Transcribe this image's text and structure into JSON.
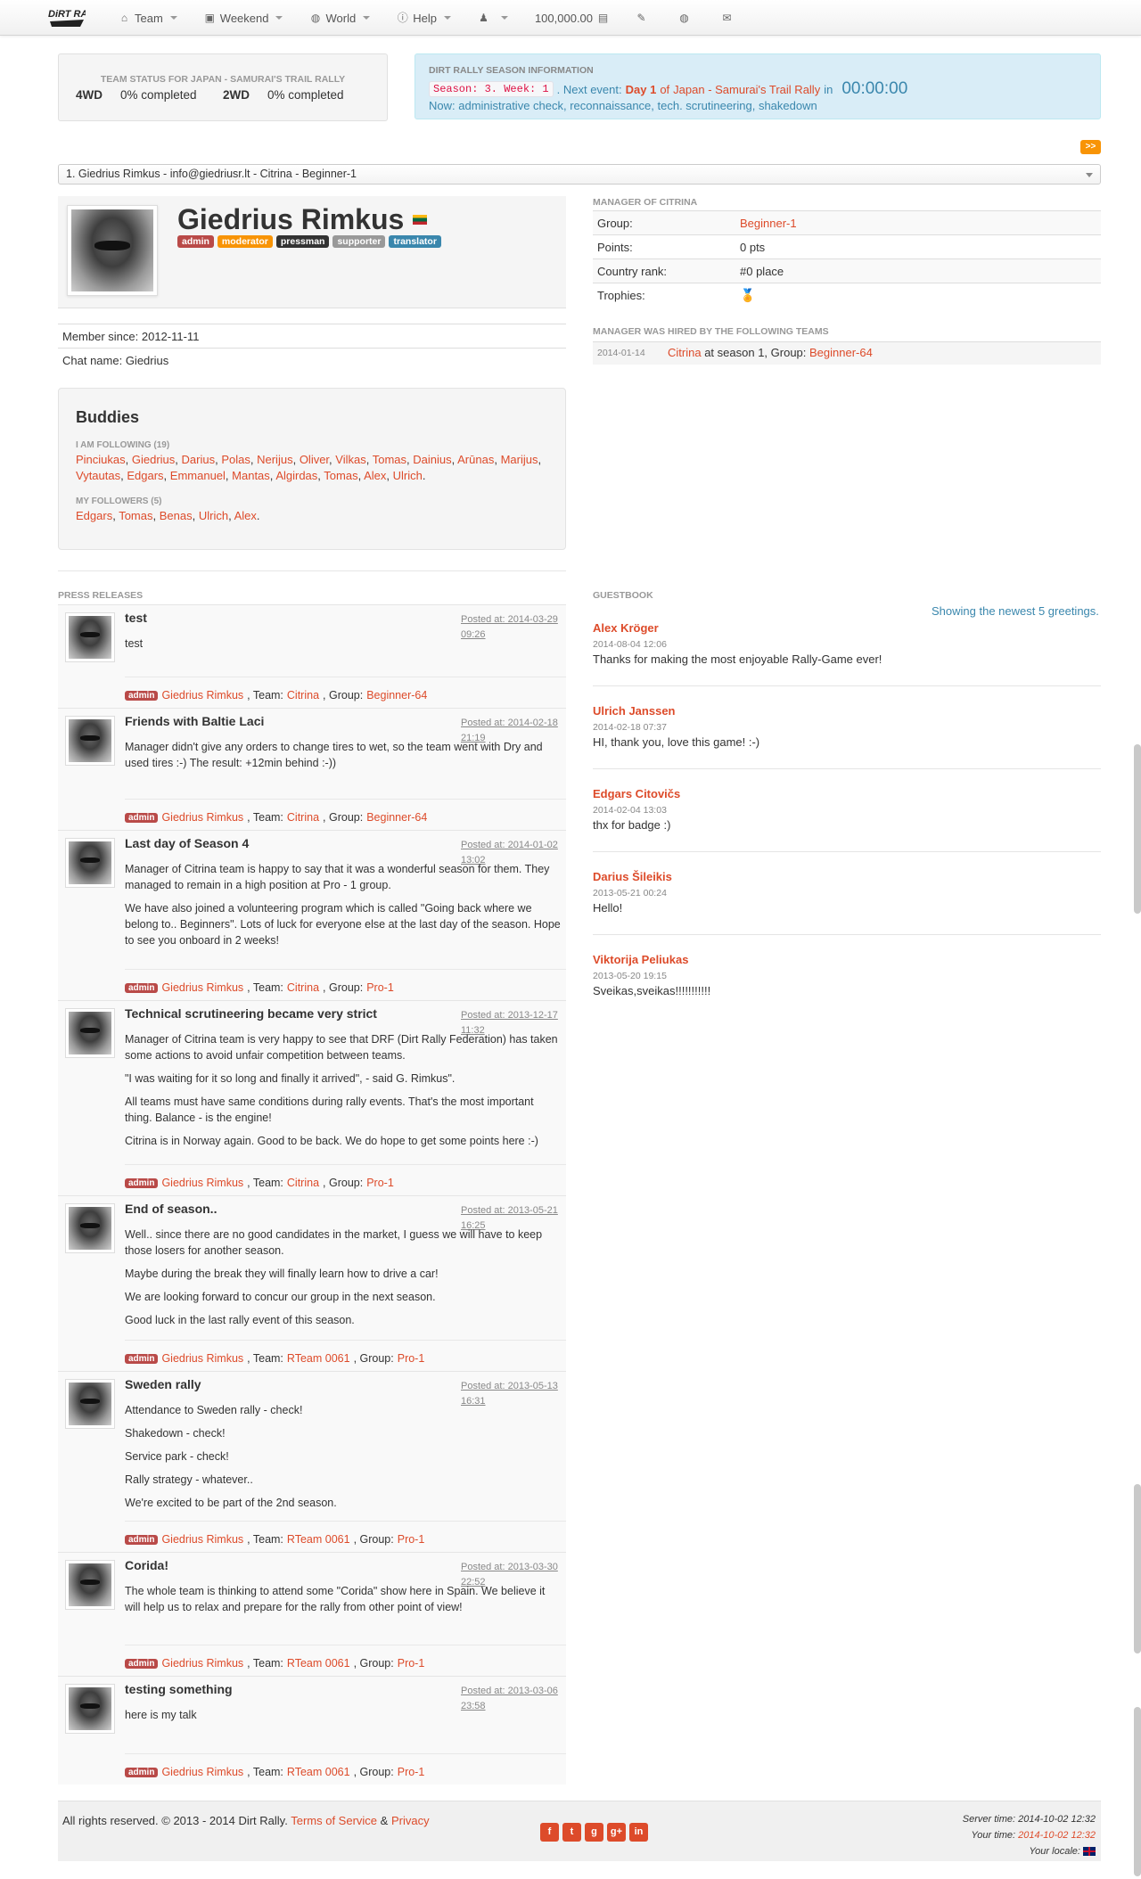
{
  "nav": {
    "logo_text": "DiRT RALLY",
    "items": [
      {
        "label": "Team",
        "icon": "home-icon"
      },
      {
        "label": "Weekend",
        "icon": "picture-icon"
      },
      {
        "label": "World",
        "icon": "globe-icon"
      },
      {
        "label": "Help",
        "icon": "info-icon"
      },
      {
        "label": "",
        "icon": "user-icon"
      },
      {
        "label": "100,000.00",
        "icon": "money-icon"
      },
      {
        "label": "",
        "icon": "edit-icon"
      },
      {
        "label": "",
        "icon": "globe-icon"
      },
      {
        "label": "",
        "icon": "envelope-icon"
      }
    ]
  },
  "team_status": {
    "title": "TEAM STATUS FOR JAPAN - SAMURAI'S TRAIL RALLY",
    "rows": [
      {
        "label": "4WD",
        "value": "0% completed"
      },
      {
        "label": "2WD",
        "value": "0% completed"
      }
    ]
  },
  "season": {
    "title": "DIRT RALLY SEASON INFORMATION",
    "code": "Season: 3. Week: 1",
    "next_event_label": ". Next event:",
    "day": "Day 1",
    "of": "of",
    "event_name": "Japan - Samurai's Trail Rally",
    "in": "in",
    "timer": "00:00:00",
    "now": "Now: administrative check, reconnaissance, tech. scrutineering, shakedown"
  },
  "next_button": ">>",
  "manager_select": "1. Giedrius Rimkus - info@giedriusr.lt - Citrina - Beginner-1",
  "profile": {
    "name": "Giedrius Rimkus",
    "badges": [
      {
        "label": "admin",
        "color": "#b94a48"
      },
      {
        "label": "moderator",
        "color": "#f89406"
      },
      {
        "label": "pressman",
        "color": "#333333"
      },
      {
        "label": "supporter",
        "color": "#999999"
      },
      {
        "label": "translator",
        "color": "#3a87ad"
      }
    ],
    "member_since": "Member since: 2012-11-11",
    "chat_name": "Chat name: Giedrius"
  },
  "buddies": {
    "title": "Buddies",
    "following_label": "I AM FOLLOWING (19)",
    "following": [
      "Pinciukas",
      "Giedrius",
      "Darius",
      "Polas",
      "Nerijus",
      "Oliver",
      "Vilkas",
      "Tomas",
      "Dainius",
      "Arūnas",
      "Marijus",
      "Vytautas",
      "Edgars",
      "Emmanuel",
      "Mantas",
      "Algirdas",
      "Tomas",
      "Alex",
      "Ulrich"
    ],
    "followers_label": "MY FOLLOWERS (5)",
    "followers": [
      "Edgars",
      "Tomas",
      "Benas",
      "Ulrich",
      "Alex"
    ]
  },
  "manager": {
    "title": "MANAGER OF CITRINA",
    "rows": [
      {
        "key": "Group:",
        "value": "Beginner-1",
        "link": true
      },
      {
        "key": "Points:",
        "value": "0 pts",
        "link": false
      },
      {
        "key": "Country rank:",
        "value": "#0 place",
        "link": false
      },
      {
        "key": "Trophies:",
        "value": "",
        "link": false
      }
    ],
    "hired_title": "MANAGER WAS HIRED BY THE FOLLOWING TEAMS",
    "hired": {
      "date": "2014-01-14",
      "team": "Citrina",
      "text": "at season 1, Group:",
      "group": "Beginner-64"
    }
  },
  "press_title": "PRESS RELEASES",
  "press": [
    {
      "title": "test",
      "date1": "Posted at: 2014-03-29",
      "date2": "09:26",
      "body": [
        "test"
      ],
      "team": "Citrina",
      "group": "Beginner-64"
    },
    {
      "title": "Friends with Baltie Laci",
      "date1": "Posted at: 2014-02-18",
      "date2": "21:19",
      "body": [
        "Manager didn't give any orders to change tires to wet, so the team went with Dry and used tires :-) The result: +12min behind :-))"
      ],
      "team": "Citrina",
      "group": "Beginner-64"
    },
    {
      "title": "Last day of Season 4",
      "date1": "Posted at: 2014-01-02",
      "date2": "13:02",
      "body": [
        "Manager of Citrina team is happy to say that it was a wonderful season for them. They managed to remain in a high position at Pro - 1 group.",
        "We have also joined a volunteering program which is called \"Going back where we belong to.. Beginners\". Lots of luck for everyone else at the last day of the season. Hope to see you onboard in 2 weeks!"
      ],
      "team": "Citrina",
      "group": "Pro-1"
    },
    {
      "title": "Technical scrutineering became very strict",
      "date1": "Posted at: 2013-12-17",
      "date2": "11:32",
      "body": [
        "Manager of Citrina team is very happy to see that DRF (Dirt Rally Federation) has taken some actions to avoid unfair competition between teams.",
        "\"I was waiting for it so long and finally it arrived\", - said G. Rimkus\".",
        "All teams must have same conditions during rally events. That's the most important thing. Balance - is the engine!",
        "Citrina is in Norway again. Good to be back. We do hope to get some points here :-)"
      ],
      "team": "Citrina",
      "group": "Pro-1"
    },
    {
      "title": "End of season..",
      "date1": "Posted at: 2013-05-21",
      "date2": "16:25",
      "body": [
        "Well.. since there are no good candidates in the market, I guess we will have to keep those losers for another season.",
        "Maybe during the break they will finally learn how to drive a car!",
        "We are looking forward to concur our group in the next season.",
        "Good luck in the last rally event of this season."
      ],
      "team": "RTeam 0061",
      "group": "Pro-1"
    },
    {
      "title": "Sweden rally",
      "date1": "Posted at: 2013-05-13",
      "date2": "16:31",
      "body": [
        "Attendance to Sweden rally - check!",
        "Shakedown - check!",
        "Service park - check!",
        "Rally strategy - whatever..",
        "We're excited to be part of the 2nd season."
      ],
      "team": "RTeam 0061",
      "group": "Pro-1"
    },
    {
      "title": "Corida!",
      "date1": "Posted at: 2013-03-30",
      "date2": "22:52",
      "body": [
        "The whole team is thinking to attend some \"Corida\" show here in Spain. We believe it will help us to relax and prepare for the rally from other point of view!"
      ],
      "team": "RTeam 0061",
      "group": "Pro-1"
    },
    {
      "title": "testing something",
      "date1": "Posted at: 2013-03-06",
      "date2": "23:58",
      "body": [
        "here is my talk"
      ],
      "team": "RTeam 0061",
      "group": "Pro-1"
    }
  ],
  "press_common": {
    "badge": "admin",
    "author": "Giedrius Rimkus",
    "team_label": ", Team:",
    "group_label": ", Group:"
  },
  "guestbook": {
    "title": "GUESTBOOK",
    "showing": "Showing the newest 5 greetings.",
    "entries": [
      {
        "name": "Alex Kröger",
        "date": "2014-08-04 12:06",
        "msg": "Thanks for making the most enjoyable Rally-Game ever!"
      },
      {
        "name": "Ulrich Janssen",
        "date": "2014-02-18 07:37",
        "msg": "HI, thank you, love this game! :-)"
      },
      {
        "name": "Edgars Citovičs",
        "date": "2014-02-04 13:03",
        "msg": "thx for badge :)"
      },
      {
        "name": "Darius Šileikis",
        "date": "2013-05-21 00:24",
        "msg": "Hello!"
      },
      {
        "name": "Viktorija Peliukas",
        "date": "2013-05-20 19:15",
        "msg": "Sveikas,sveikas!!!!!!!!!!!"
      }
    ]
  },
  "footer": {
    "copy": "All rights reserved. © 2013 - 2014 Dirt Rally.",
    "terms": "Terms of Service",
    "amp": "&",
    "privacy": "Privacy",
    "server_time": "Server time: 2014-10-02 12:32",
    "your_time_label": "Your time:",
    "your_time": "2014-10-02 12:32",
    "locale": "Your locale:"
  }
}
